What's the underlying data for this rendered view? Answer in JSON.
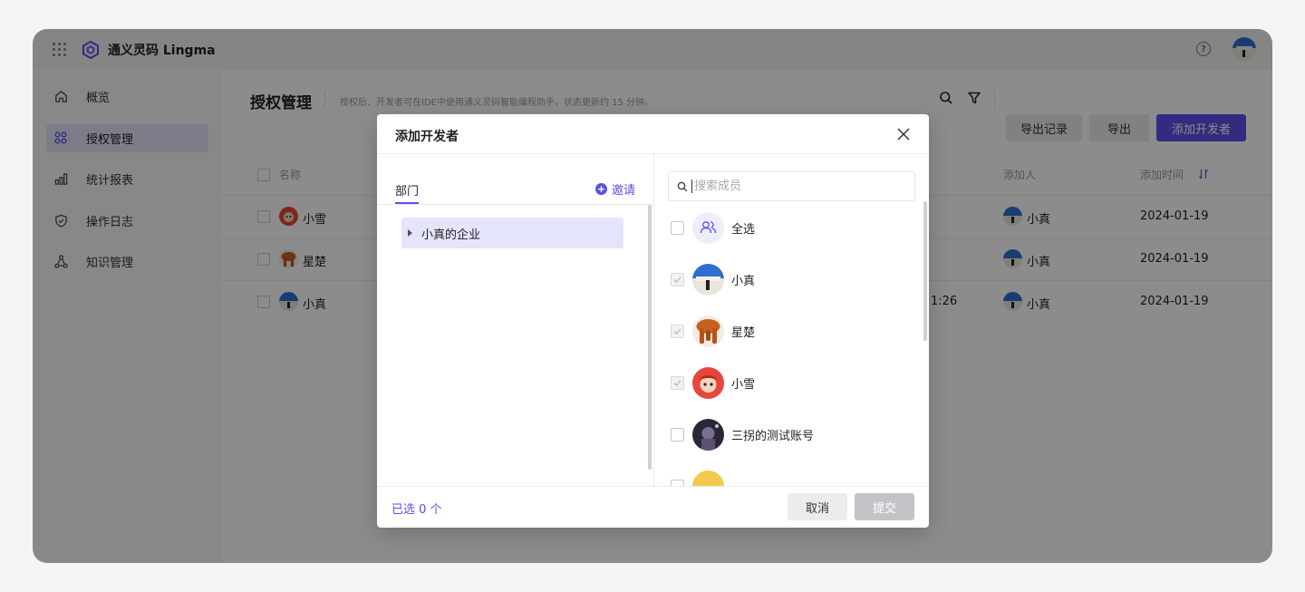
{
  "header": {
    "app_title": "通义灵码 Lingma",
    "help_glyph": "?"
  },
  "sidebar": {
    "items": [
      {
        "label": "概览",
        "icon": "home-icon"
      },
      {
        "label": "授权管理",
        "icon": "apps-grid-icon",
        "active": true
      },
      {
        "label": "统计报表",
        "icon": "bar-chart-icon"
      },
      {
        "label": "操作日志",
        "icon": "shield-check-icon"
      },
      {
        "label": "知识管理",
        "icon": "nodes-icon"
      }
    ]
  },
  "main": {
    "title": "授权管理",
    "description": "授权后、开发者可在IDE中使用通义灵码智能编程助手，状态更新约 15 分钟。",
    "buttons": {
      "export_records": "导出记录",
      "export": "导出",
      "add_developer": "添加开发者"
    },
    "table": {
      "columns": {
        "name": "名称",
        "added_by": "添加人",
        "added_time": "添加时间"
      },
      "rows": [
        {
          "name": "小雪",
          "middle": "",
          "added_by": "小真",
          "added_time": "2024-01-19"
        },
        {
          "name": "星楚",
          "middle": "",
          "added_by": "小真",
          "added_time": "2024-01-19"
        },
        {
          "name": "小真",
          "middle": "1:26",
          "added_by": "小真",
          "added_time": "2024-01-19"
        }
      ]
    }
  },
  "modal": {
    "title": "添加开发者",
    "dept_tab": "部门",
    "invite_label": "邀请",
    "tree_node": "小真的企业",
    "search_placeholder": "搜索成员",
    "select_all": "全选",
    "members": [
      {
        "name": "小真",
        "checked": true
      },
      {
        "name": "星楚",
        "checked": true
      },
      {
        "name": "小雪",
        "checked": true
      },
      {
        "name": "三拐的测试账号",
        "checked": false
      }
    ],
    "selected_count": "已选 0 个",
    "cancel": "取消",
    "submit": "提交"
  },
  "colors": {
    "primary": "#5b4fe9",
    "active_nav_bg": "#e4e4fb",
    "overlay": "rgba(0,0,0,0.45)"
  }
}
